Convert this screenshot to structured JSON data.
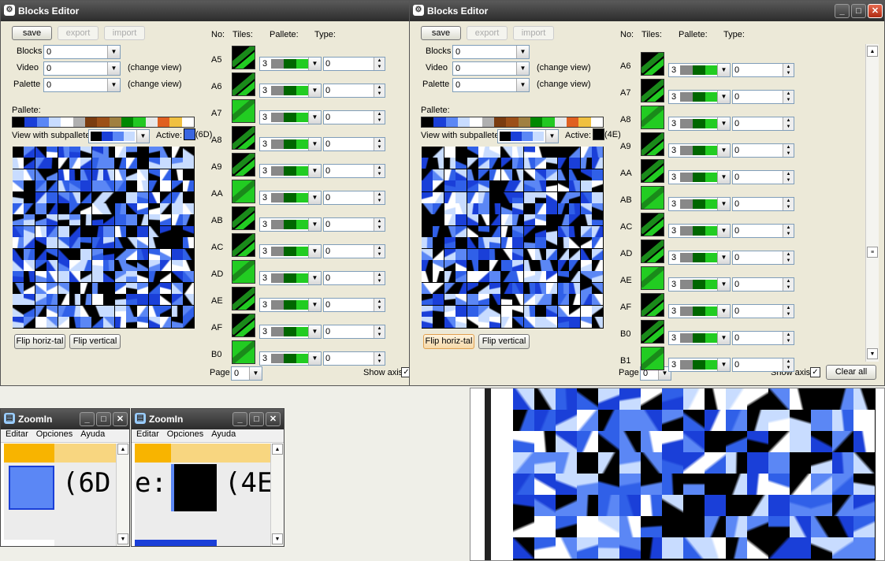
{
  "left_editor": {
    "title": "Blocks Editor",
    "buttons": {
      "save": "save",
      "export": "export",
      "import": "import"
    },
    "fields": {
      "blocks_label": "Blocks",
      "blocks_value": "0",
      "video_label": "Video",
      "video_value": "0",
      "video_hint": "(change view)",
      "palette_label": "Palette",
      "palette_value": "0",
      "palette_hint": "(change view)"
    },
    "pallete_label": "Pallete:",
    "subpallete_label": "View with subpallete:",
    "active_label": "Active:",
    "active_value": "(6D)",
    "columns": {
      "no": "No:",
      "tiles": "Tiles:",
      "pallete": "Pallete:",
      "type": "Type:"
    },
    "rows": [
      {
        "no": "A5",
        "pal": "3",
        "type": "0"
      },
      {
        "no": "A6",
        "pal": "3",
        "type": "0"
      },
      {
        "no": "A7",
        "pal": "3",
        "type": "0"
      },
      {
        "no": "A8",
        "pal": "3",
        "type": "0"
      },
      {
        "no": "A9",
        "pal": "3",
        "type": "0"
      },
      {
        "no": "AA",
        "pal": "3",
        "type": "0"
      },
      {
        "no": "AB",
        "pal": "3",
        "type": "0"
      },
      {
        "no": "AC",
        "pal": "3",
        "type": "0"
      },
      {
        "no": "AD",
        "pal": "3",
        "type": "0"
      },
      {
        "no": "AE",
        "pal": "3",
        "type": "0"
      },
      {
        "no": "AF",
        "pal": "3",
        "type": "0"
      },
      {
        "no": "B0",
        "pal": "3",
        "type": "0"
      }
    ],
    "flip_h": "Flip horiz-tal",
    "flip_v": "Flip vertical",
    "page_label": "Page",
    "page_value": "0",
    "show_axis": "Show axis"
  },
  "right_editor": {
    "title": "Blocks Editor",
    "buttons": {
      "save": "save",
      "export": "export",
      "import": "import"
    },
    "fields": {
      "blocks_label": "Blocks",
      "blocks_value": "0",
      "video_label": "Video",
      "video_value": "0",
      "video_hint": "(change view)",
      "palette_label": "Palette",
      "palette_value": "0",
      "palette_hint": "(change view)"
    },
    "pallete_label": "Pallete:",
    "subpallete_label": "View with subpallete:",
    "active_label": "Active:",
    "active_value": "(4E)",
    "columns": {
      "no": "No:",
      "tiles": "Tiles:",
      "pallete": "Pallete:",
      "type": "Type:"
    },
    "rows": [
      {
        "no": "A6",
        "pal": "3",
        "type": "0"
      },
      {
        "no": "A7",
        "pal": "3",
        "type": "0"
      },
      {
        "no": "A8",
        "pal": "3",
        "type": "0"
      },
      {
        "no": "A9",
        "pal": "3",
        "type": "0"
      },
      {
        "no": "AA",
        "pal": "3",
        "type": "0"
      },
      {
        "no": "AB",
        "pal": "3",
        "type": "0"
      },
      {
        "no": "AC",
        "pal": "3",
        "type": "0"
      },
      {
        "no": "AD",
        "pal": "3",
        "type": "0"
      },
      {
        "no": "AE",
        "pal": "3",
        "type": "0"
      },
      {
        "no": "AF",
        "pal": "3",
        "type": "0"
      },
      {
        "no": "B0",
        "pal": "3",
        "type": "0"
      },
      {
        "no": "B1",
        "pal": "3",
        "type": "0"
      }
    ],
    "flip_h": "Flip horiz-tal",
    "flip_v": "Flip vertical",
    "page_label": "Page",
    "page_value": "0",
    "show_axis": "Show axis",
    "clear_all": "Clear all"
  },
  "palette_colors": [
    "#000000",
    "#1a3fd8",
    "#5b87f5",
    "#c8dcff",
    "#ffffff",
    "#b0b0b0",
    "#7a3c10",
    "#9c5018",
    "#a08040",
    "#008800",
    "#22c822",
    "#e8e8e8",
    "#e06020",
    "#f0c040",
    "#ffffff"
  ],
  "zoom_left": {
    "title": "ZoomIn",
    "menu": [
      "Editar",
      "Opciones",
      "Ayuda"
    ],
    "text": "(6D."
  },
  "zoom_right": {
    "title": "ZoomIn",
    "menu": [
      "Editar",
      "Opciones",
      "Ayuda"
    ],
    "text_left": "e:",
    "text_right": "(4E"
  }
}
